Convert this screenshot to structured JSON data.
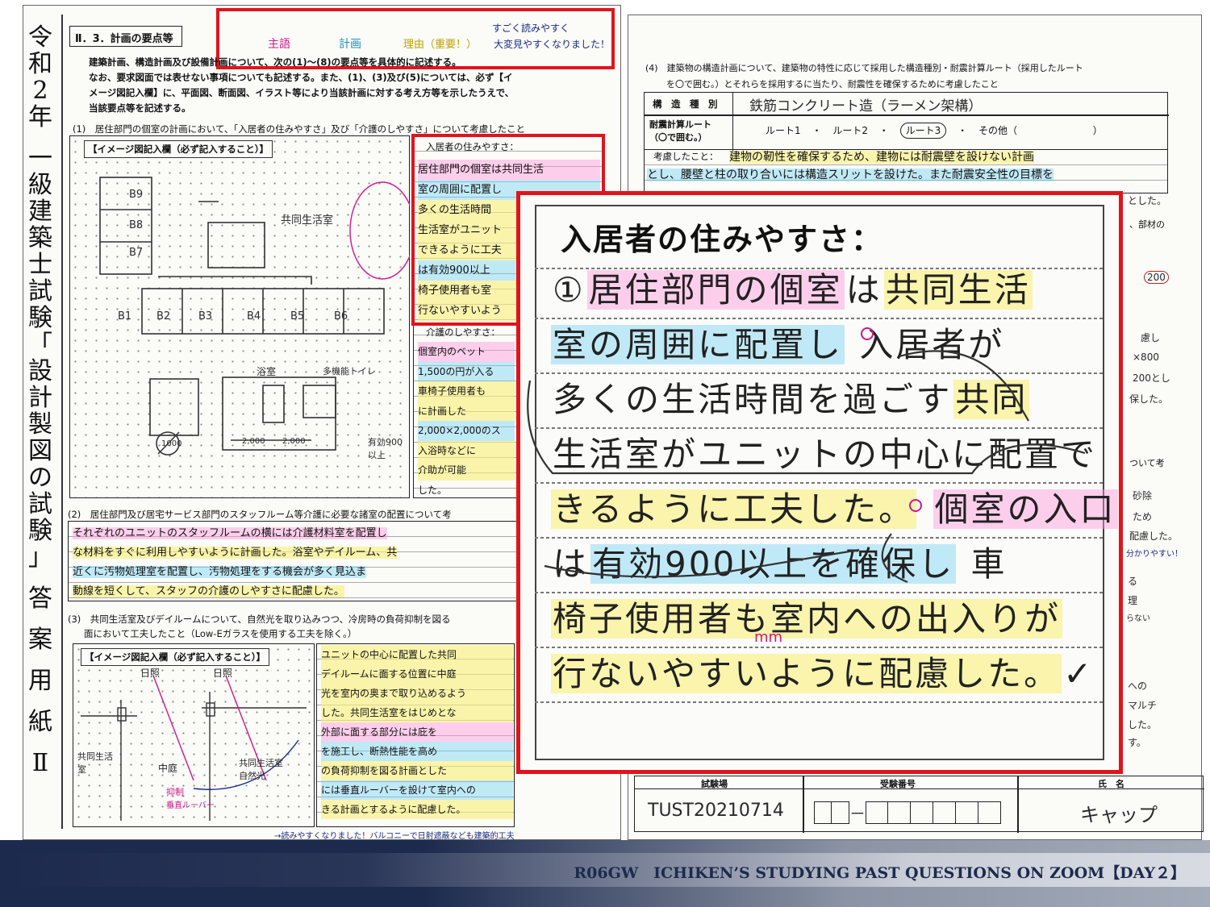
{
  "title_vertical": [
    "令",
    "和",
    "2",
    "年",
    "",
    "一",
    "級",
    "建",
    "築",
    "士",
    "試",
    "験",
    "「",
    "設",
    "計",
    "製",
    "図",
    "の",
    "試",
    "験",
    "」",
    "",
    "答",
    "",
    "案",
    "",
    "用",
    "",
    "紙",
    "",
    "Ⅱ"
  ],
  "left": {
    "section_header": "Ⅱ．3．計画の要点等",
    "legend": {
      "shugo": "主語",
      "keikaku": "計画",
      "riyu": "理由（重要！）",
      "note_line1": "すごく読みやすく",
      "note_line2": "大変見やすくなりました！"
    },
    "intro_lines": [
      "建築計画、構造計画及び設備計画について、次の(1)～(8)の要点等を具体的に記述する。",
      "なお、要求図面では表せない事項についても記述する。また、(1)、(3)及び(5)については、必ず【イ",
      "メージ図記入欄】に、平面図、断面図、イラスト等により当該計画に対する考え方等を示したうえで、",
      "当該要点等を記述する。"
    ],
    "q1": "(1)　居住部門の個室の計画において、「入居者の住みやすさ」及び「介護のしやすさ」について考慮したこと",
    "image_box_label": "【イメージ図記入欄（必ず記入すること）】",
    "sketch_rooms": [
      "B9",
      "B8",
      "B7",
      "B1",
      "B2",
      "B3",
      "B4",
      "B5",
      "B6"
    ],
    "sketch_notes": [
      "共同生活室",
      "浴室",
      "多機能トイレ",
      "有効900以上",
      "2,000",
      "2,000",
      "1000"
    ],
    "side_label_sumiyasusa": "入居者の住みやすさ：",
    "side_label_kaigo": "介護のしやすさ：",
    "side_lines": [
      "居住部門の個室は共同生活",
      "室の周囲に配置し",
      "多くの生活時間",
      "生活室がユニット",
      "できるように工夫",
      "は有効900以上",
      "椅子使用者も室",
      "行ないやすいよう"
    ],
    "kaigo_lines": [
      "個室内のベット",
      "1,500の円が入る",
      "車椅子使用者も",
      "に計画した",
      "2,000×2,000のス",
      "入浴時などに",
      "介助が可能",
      "した。"
    ],
    "q2": "(2)　居住部門及び居宅サービス部門のスタッフルーム等介護に必要な諸室の配置について考",
    "q2_lines": [
      "それぞれのユニットのスタッフルームの横には介護材料室を配置し",
      "な材料をすぐに利用しやすいように計画した。浴室やデイルーム、共",
      "近くに汚物処理室を配置し、汚物処理をする機会が多く見込ま",
      "動線を短くして、スタッフの介護のしやすさに配慮した。"
    ],
    "q3_line1": "(3)　共同生活室及びデイルームについて、自然光を取り込みつつ、冷房時の負荷抑制を図る",
    "q3_line2": "面において工夫したこと（Low-Eガラスを使用する工夫を除く。）",
    "image_box_label2": "【イメージ図記入欄（必ず記入すること）】",
    "q3_lines": [
      "ユニットの中心に配置した共同",
      "デイルームに面する位置に中庭",
      "光を室内の奥まで取り込めるよう",
      "した。共同生活室をはじめとな",
      "外部に面する部分には庇を",
      "を施工し、断熱性能を高め",
      "の負荷抑制を図る計画とした",
      "には垂直ルーバーを設けて室内への",
      "きる計画とするように配慮した。"
    ],
    "q3_sketch_notes": [
      "日照",
      "日照",
      "共同生活室",
      "中庭",
      "抑制",
      "垂直ルーバー",
      "共同生活室",
      "自然光"
    ],
    "bottom_note": "→読みやすくなりました！バルコニーで日射遮蔽なども建築的工夫"
  },
  "right": {
    "q4_line1": "(4)　建築物の構造計画について、建築物の特性に応じて採用した構造種別・耐震計算ルート（採用したルート",
    "q4_line2": "を〇で囲む。）とそれらを採用するに当たり、耐震性を確保するために考慮したこと",
    "structure_label": "構　造　種　別",
    "structure_value": "鉄筋コンクリート造（ラーメン架構）",
    "route_label1": "耐震計算ルート",
    "route_label2": "（〇で囲む。）",
    "routes": [
      "ルート1",
      "ルート2",
      "ルート3",
      "その他（",
      "）"
    ],
    "consider_label": "考慮したこと：",
    "consider_lines": [
      "建物の靭性を確保するため、建物には耐震壁を設けない計画",
      "とし、腰壁と柱の取り合いには構造スリットを設けた。また耐震安全性の目標を"
    ],
    "side_fragments": [
      "とした。",
      "、部材の",
      "200",
      "慮し",
      "×800",
      "200とし",
      "保した。",
      "ついて考",
      "砂除",
      "ため",
      "配慮した。",
      "分かりやすい！",
      "る",
      "理",
      "らない",
      "への",
      "マルチ",
      "した。",
      "す。"
    ],
    "footer_headers": [
      "試験場",
      "受験番号",
      "氏　名"
    ],
    "footer_values": {
      "exam_site": "TUST20210714",
      "exam_number_dash": "－",
      "name": "キャップ"
    }
  },
  "zoom": {
    "title": "入居者の住みやすさ：",
    "lines": [
      [
        {
          "t": "①",
          "c": "none"
        },
        {
          "t": "居住部門の個室",
          "c": "pink"
        },
        {
          "t": "は",
          "c": "none"
        },
        {
          "t": "共同生活",
          "c": "yellow"
        }
      ],
      [
        {
          "t": "室の周囲に配置し",
          "c": "blue"
        },
        {
          "t": " 入居者が",
          "c": "none"
        }
      ],
      [
        {
          "t": "多くの生活時間を過ごす",
          "c": "none"
        },
        {
          "t": "共同",
          "c": "yellow"
        }
      ],
      [
        {
          "t": "生活室がユニットの中心に配置で",
          "c": "none"
        }
      ],
      [
        {
          "t": "きるように工夫した。",
          "c": "yellow"
        },
        {
          "t": " ",
          "c": "none"
        },
        {
          "t": "個室の入口",
          "c": "pink"
        }
      ],
      [
        {
          "t": "は",
          "c": "none"
        },
        {
          "t": "有効900以上を確保し",
          "c": "blue"
        },
        {
          "t": " 車",
          "c": "none"
        }
      ],
      [
        {
          "t": "椅子使用者も室内への出入りが",
          "c": "yellow"
        }
      ],
      [
        {
          "t": "行ないやすいように配慮した。",
          "c": "yellow"
        },
        {
          "t": "✓",
          "c": "none"
        }
      ]
    ],
    "annotation": "mm"
  },
  "banner": {
    "text": "R06GW　ICHIKEN’S STUDYING PAST QUESTIONS ON ZOOM【DAY２】"
  },
  "colors": {
    "highlight_red": "#e0141c",
    "banner_navy": "#1c2a4e",
    "marker_pink": "#ff96dc",
    "marker_blue": "#78d2f5",
    "marker_yellow": "#faf078"
  }
}
